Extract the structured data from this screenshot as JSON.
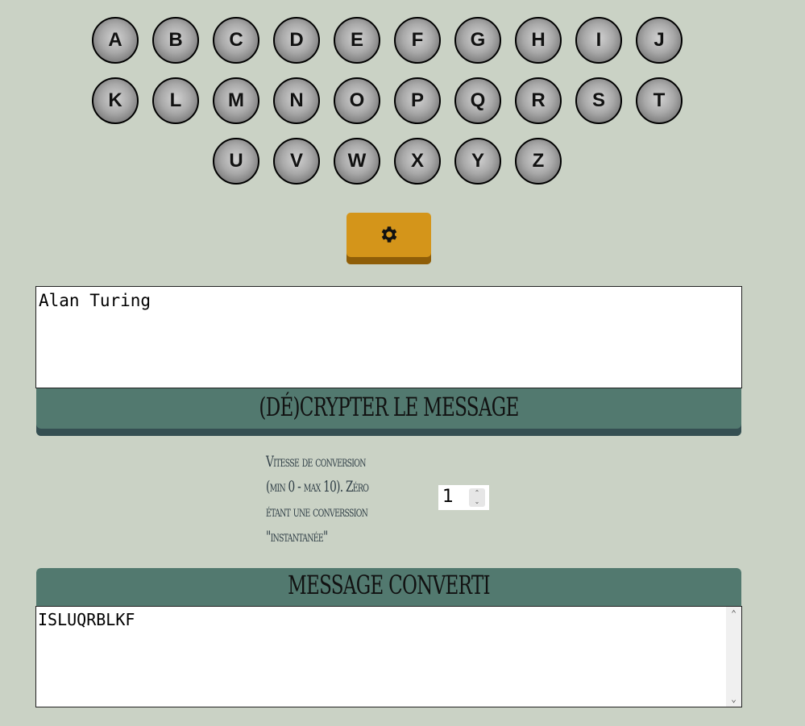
{
  "keyboard": {
    "row1": [
      "A",
      "B",
      "C",
      "D",
      "E",
      "F",
      "G",
      "H",
      "I",
      "J"
    ],
    "row2": [
      "K",
      "L",
      "M",
      "N",
      "O",
      "P",
      "Q",
      "R",
      "S",
      "T"
    ],
    "row3": [
      "U",
      "V",
      "W",
      "X",
      "Y",
      "Z"
    ]
  },
  "settings": {
    "icon": "gear-icon",
    "color": "#d4951a"
  },
  "input": {
    "value": "Alan Turing"
  },
  "crypt_button": {
    "label": "(DÉ)CRYPTER LE MESSAGE"
  },
  "speed": {
    "label_lines": [
      "Vitesse de conversion",
      "(min 0 - max 10). Zéro",
      "étant une converssion",
      "\"instantanée\""
    ],
    "value": "1"
  },
  "output": {
    "header": "MESSAGE CONVERTI",
    "value": "ISLUQRBLKF"
  },
  "colors": {
    "background": "#cad2c5",
    "accent": "#52796f",
    "accent_dark": "#354f52",
    "settings": "#d4951a"
  }
}
